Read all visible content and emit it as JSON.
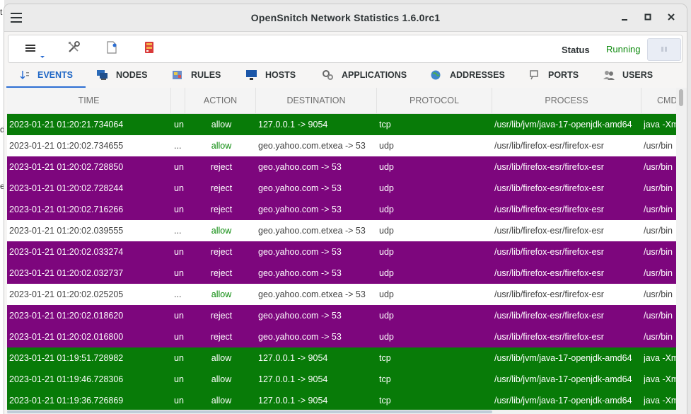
{
  "window": {
    "title": "OpenSnitch Network Statistics 1.6.0rc1"
  },
  "background_chars": [
    "t",
    "d",
    "e"
  ],
  "toolbar": {
    "status_label": "Status",
    "status_value": "Running"
  },
  "tabs": [
    {
      "label": "EVENTS",
      "icon": "events-icon"
    },
    {
      "label": "NODES",
      "icon": "nodes-icon"
    },
    {
      "label": "RULES",
      "icon": "rules-icon"
    },
    {
      "label": "HOSTS",
      "icon": "hosts-icon"
    },
    {
      "label": "APPLICATIONS",
      "icon": "applications-icon"
    },
    {
      "label": "ADDRESSES",
      "icon": "addresses-icon"
    },
    {
      "label": "PORTS",
      "icon": "ports-icon"
    },
    {
      "label": "USERS",
      "icon": "users-icon"
    }
  ],
  "table": {
    "columns": [
      "TIME",
      "",
      "ACTION",
      "DESTINATION",
      "PROTOCOL",
      "PROCESS",
      "CMD"
    ],
    "rows": [
      {
        "time": "2023-01-21 01:20:21.734064",
        "node": "un",
        "action": "allow",
        "destination": "127.0.0.1  ->  9054",
        "protocol": "tcp",
        "process": "/usr/lib/jvm/java-17-openjdk-amd64",
        "cmd": "java -Xm",
        "type": "allow"
      },
      {
        "time": "2023-01-21 01:20:02.734655",
        "node": "...",
        "action": "allow",
        "destination": "geo.yahoo.com.etxea  ->  53",
        "protocol": "udp",
        "process": "/usr/lib/firefox-esr/firefox-esr",
        "cmd": "/usr/bin",
        "type": "plain"
      },
      {
        "time": "2023-01-21 01:20:02.728850",
        "node": "un",
        "action": "reject",
        "destination": "geo.yahoo.com  ->  53",
        "protocol": "udp",
        "process": "/usr/lib/firefox-esr/firefox-esr",
        "cmd": "/usr/bin",
        "type": "reject"
      },
      {
        "time": "2023-01-21 01:20:02.728244",
        "node": "un",
        "action": "reject",
        "destination": "geo.yahoo.com  ->  53",
        "protocol": "udp",
        "process": "/usr/lib/firefox-esr/firefox-esr",
        "cmd": "/usr/bin",
        "type": "reject"
      },
      {
        "time": "2023-01-21 01:20:02.716266",
        "node": "un",
        "action": "reject",
        "destination": "geo.yahoo.com  ->  53",
        "protocol": "udp",
        "process": "/usr/lib/firefox-esr/firefox-esr",
        "cmd": "/usr/bin",
        "type": "reject"
      },
      {
        "time": "2023-01-21 01:20:02.039555",
        "node": "...",
        "action": "allow",
        "destination": "geo.yahoo.com.etxea  ->  53",
        "protocol": "udp",
        "process": "/usr/lib/firefox-esr/firefox-esr",
        "cmd": "/usr/bin",
        "type": "plain"
      },
      {
        "time": "2023-01-21 01:20:02.033274",
        "node": "un",
        "action": "reject",
        "destination": "geo.yahoo.com  ->  53",
        "protocol": "udp",
        "process": "/usr/lib/firefox-esr/firefox-esr",
        "cmd": "/usr/bin",
        "type": "reject"
      },
      {
        "time": "2023-01-21 01:20:02.032737",
        "node": "un",
        "action": "reject",
        "destination": "geo.yahoo.com  ->  53",
        "protocol": "udp",
        "process": "/usr/lib/firefox-esr/firefox-esr",
        "cmd": "/usr/bin",
        "type": "reject"
      },
      {
        "time": "2023-01-21 01:20:02.025205",
        "node": "...",
        "action": "allow",
        "destination": "geo.yahoo.com.etxea  ->  53",
        "protocol": "udp",
        "process": "/usr/lib/firefox-esr/firefox-esr",
        "cmd": "/usr/bin",
        "type": "plain"
      },
      {
        "time": "2023-01-21 01:20:02.018620",
        "node": "un",
        "action": "reject",
        "destination": "geo.yahoo.com  ->  53",
        "protocol": "udp",
        "process": "/usr/lib/firefox-esr/firefox-esr",
        "cmd": "/usr/bin",
        "type": "reject"
      },
      {
        "time": "2023-01-21 01:20:02.016800",
        "node": "un",
        "action": "reject",
        "destination": "geo.yahoo.com  ->  53",
        "protocol": "udp",
        "process": "/usr/lib/firefox-esr/firefox-esr",
        "cmd": "/usr/bin",
        "type": "reject"
      },
      {
        "time": "2023-01-21 01:19:51.728982",
        "node": "un",
        "action": "allow",
        "destination": "127.0.0.1  ->  9054",
        "protocol": "tcp",
        "process": "/usr/lib/jvm/java-17-openjdk-amd64",
        "cmd": "java -Xm",
        "type": "allow"
      },
      {
        "time": "2023-01-21 01:19:46.728306",
        "node": "un",
        "action": "allow",
        "destination": "127.0.0.1  ->  9054",
        "protocol": "tcp",
        "process": "/usr/lib/jvm/java-17-openjdk-amd64",
        "cmd": "java -Xm",
        "type": "allow"
      },
      {
        "time": "2023-01-21 01:19:36.726869",
        "node": "un",
        "action": "allow",
        "destination": "127.0.0.1  ->  9054",
        "protocol": "tcp",
        "process": "/usr/lib/jvm/java-17-openjdk-amd64",
        "cmd": "java -Xm",
        "type": "allow"
      }
    ]
  },
  "colors": {
    "allow_row": "#087b08",
    "reject_row": "#7d067d",
    "running": "#0d8a0d",
    "active_tab": "#1e66c5"
  }
}
